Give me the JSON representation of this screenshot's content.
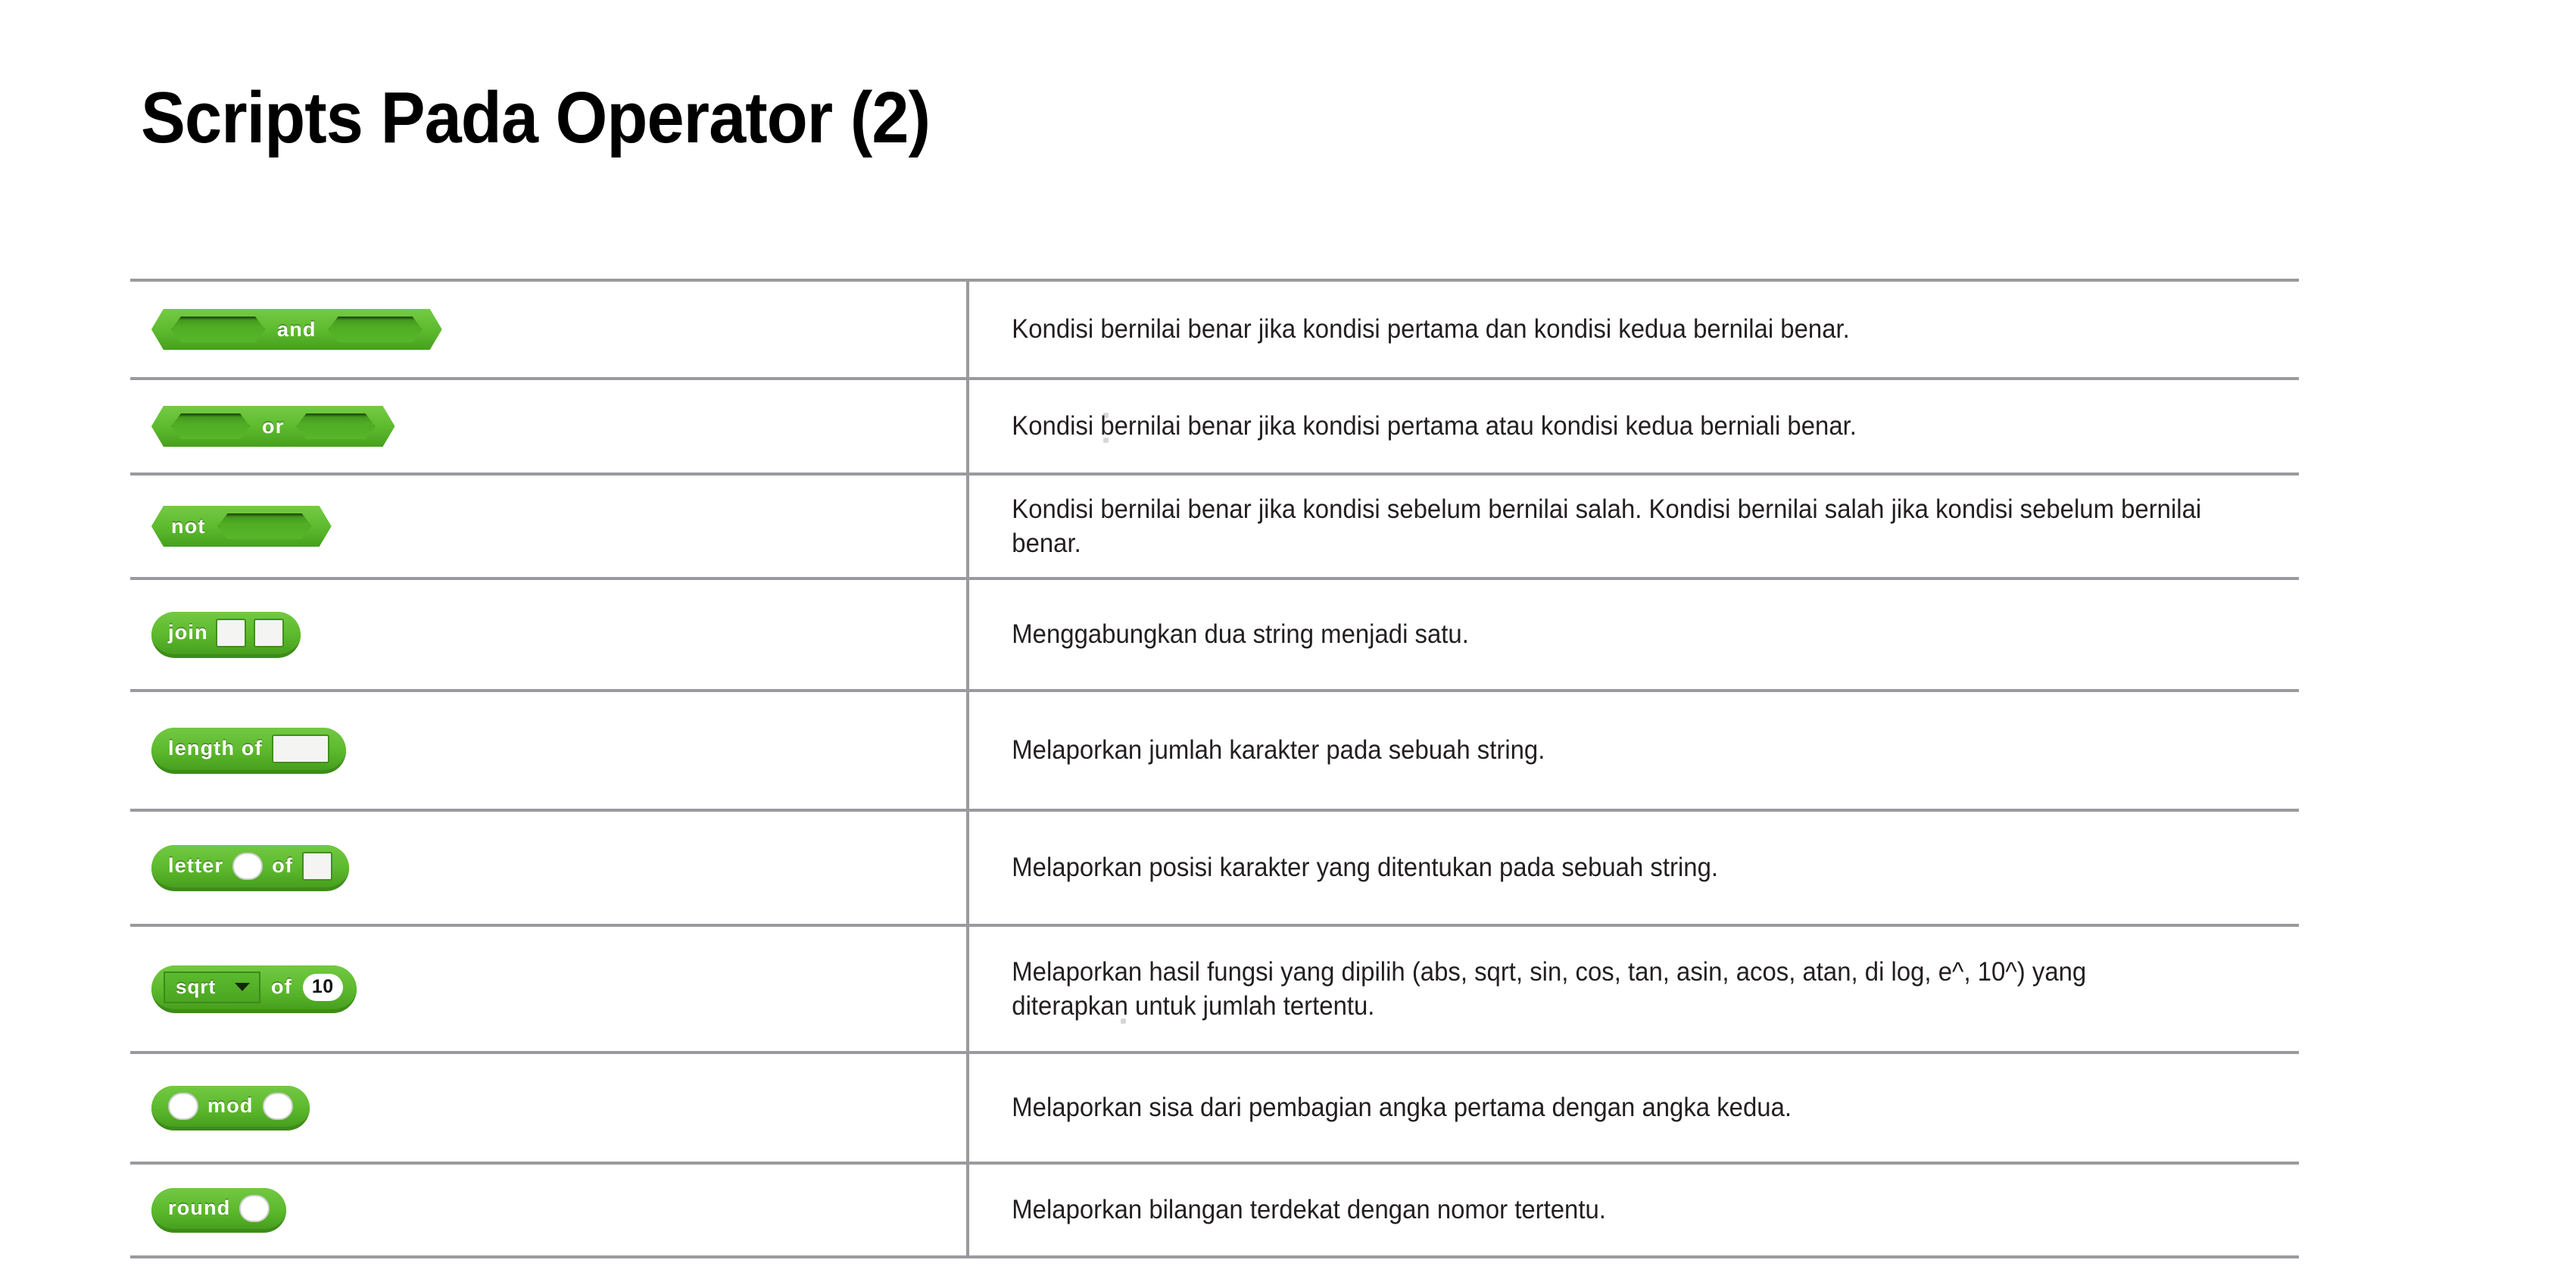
{
  "slide": {
    "title": "Scripts Pada Operator (2)"
  },
  "colors": {
    "block_green": "#5cb92c",
    "block_green_dark": "#3d8c19",
    "rule_gray": "#9a9a9e",
    "text": "#231f20"
  },
  "table": {
    "rows": [
      {
        "block": {
          "id": "and-block",
          "shape": "hexagon",
          "label": "and",
          "parts": [
            {
              "type": "hex-slot"
            },
            {
              "type": "label",
              "text": "and"
            },
            {
              "type": "hex-slot"
            }
          ]
        },
        "description": "Kondisi bernilai benar jika kondisi pertama dan kondisi kedua bernilai benar."
      },
      {
        "block": {
          "id": "or-block",
          "shape": "hexagon",
          "label": "or",
          "parts": [
            {
              "type": "hex-slot"
            },
            {
              "type": "label",
              "text": "or"
            },
            {
              "type": "hex-slot"
            }
          ]
        },
        "description": "Kondisi bernilai benar jika kondisi pertama atau kondisi kedua berniali benar."
      },
      {
        "block": {
          "id": "not-block",
          "shape": "hexagon",
          "label": "not",
          "parts": [
            {
              "type": "label",
              "text": "not"
            },
            {
              "type": "hex-slot"
            }
          ]
        },
        "description": "Kondisi bernilai benar jika kondisi sebelum bernilai salah. Kondisi bernilai salah jika kondisi sebelum bernilai benar."
      },
      {
        "block": {
          "id": "join-block",
          "shape": "oval",
          "label": "join",
          "parts": [
            {
              "type": "label",
              "text": "join"
            },
            {
              "type": "rect-input"
            },
            {
              "type": "rect-input"
            }
          ]
        },
        "description": "Menggabungkan dua string menjadi satu."
      },
      {
        "block": {
          "id": "length-of-block",
          "shape": "oval",
          "label": "length of",
          "parts": [
            {
              "type": "label",
              "text": "length of"
            },
            {
              "type": "rect-input-wide"
            }
          ]
        },
        "description": "Melaporkan jumlah karakter pada sebuah string."
      },
      {
        "block": {
          "id": "letter-of-block",
          "shape": "oval",
          "label": "letter of",
          "parts": [
            {
              "type": "label",
              "text": "letter"
            },
            {
              "type": "round-input"
            },
            {
              "type": "label",
              "text": "of"
            },
            {
              "type": "rect-input"
            }
          ]
        },
        "description": "Melaporkan posisi karakter yang ditentukan pada sebuah string."
      },
      {
        "block": {
          "id": "sqrt-of-block",
          "shape": "oval",
          "label": "sqrt of 10",
          "dropdown_value": "sqrt",
          "number_value": "10",
          "parts": [
            {
              "type": "dropdown",
              "text": "sqrt"
            },
            {
              "type": "label",
              "text": "of"
            },
            {
              "type": "number-input",
              "text": "10"
            }
          ]
        },
        "description": "Melaporkan hasil fungsi yang dipilih (abs, sqrt, sin, cos, tan, asin, acos, atan, di log, e^, 10^) yang diterapkan untuk jumlah tertentu."
      },
      {
        "block": {
          "id": "mod-block",
          "shape": "oval",
          "label": "mod",
          "parts": [
            {
              "type": "round-input"
            },
            {
              "type": "label",
              "text": "mod"
            },
            {
              "type": "round-input"
            }
          ]
        },
        "description": "Melaporkan sisa dari pembagian angka pertama dengan angka kedua."
      },
      {
        "block": {
          "id": "round-block",
          "shape": "oval",
          "label": "round",
          "parts": [
            {
              "type": "label",
              "text": "round"
            },
            {
              "type": "round-input"
            }
          ]
        },
        "description": "Melaporkan bilangan terdekat dengan nomor tertentu."
      }
    ]
  }
}
